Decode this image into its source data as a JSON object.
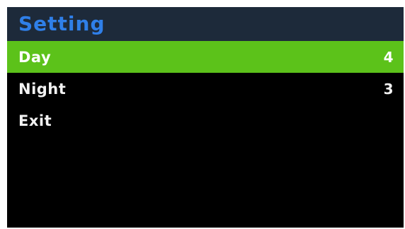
{
  "title": "Setting",
  "menu": {
    "items": [
      {
        "label": "Day",
        "value": "4",
        "selected": true
      },
      {
        "label": "Night",
        "value": "3",
        "selected": false
      },
      {
        "label": "Exit",
        "value": "",
        "selected": false
      }
    ]
  },
  "colors": {
    "background": "#000000",
    "title_bar": "#1d2a3a",
    "title_text": "#2f7fe8",
    "selected_row": "#5cc21a",
    "text": "#f2f2f2"
  }
}
